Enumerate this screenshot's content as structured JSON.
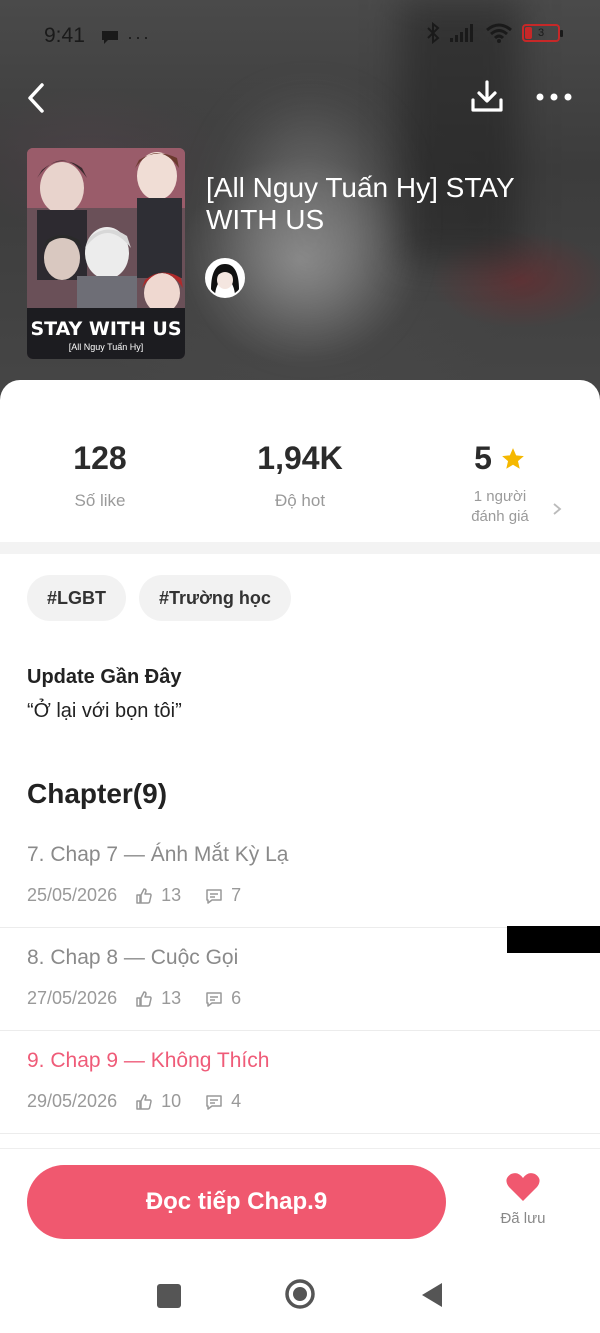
{
  "status_bar": {
    "time": "9:41",
    "left_icons": "● ···",
    "battery": "3"
  },
  "header": {
    "title": "[All Nguy Tuấn Hy] STAY WITH US",
    "cover_title": "STAY WITH US",
    "cover_subtitle": "[All Nguy Tuấn Hy]"
  },
  "stats": {
    "likes_value": "128",
    "likes_label": "Số like",
    "hot_value": "1,94K",
    "hot_label": "Độ hot",
    "rating_value": "5",
    "rating_label_line1": "1 người",
    "rating_label_line2": "đánh giá"
  },
  "tags": [
    "#LGBT",
    "#Trường học"
  ],
  "update": {
    "title": "Update Gần Đây",
    "text": "“Ở lại với bọn tôi”"
  },
  "chapter_heading": "Chapter(9)",
  "chapters": [
    {
      "name": "7. Chap 7 — Ánh Mắt Kỳ Lạ",
      "date": "25/05/2026",
      "likes": "13",
      "comments": "7",
      "active": false
    },
    {
      "name": "8. Chap 8 — Cuộc Gọi",
      "date": "27/05/2026",
      "likes": "13",
      "comments": "6",
      "active": false
    },
    {
      "name": "9. Chap 9 — Không Thích",
      "date": "29/05/2026",
      "likes": "10",
      "comments": "4",
      "active": true
    }
  ],
  "bottom": {
    "read_button": "Đọc tiếp Chap.9",
    "saved_label": "Đã lưu"
  },
  "colors": {
    "accent": "#f0586f",
    "active_chapter": "#ef5b78",
    "star": "#f5b800",
    "heart": "#f0586f"
  },
  "icons": {
    "back": "back-icon",
    "download": "download-icon",
    "more": "more-icon",
    "star": "star-icon",
    "like": "thumb-up-icon",
    "comment": "comment-icon",
    "heart": "heart-icon"
  }
}
